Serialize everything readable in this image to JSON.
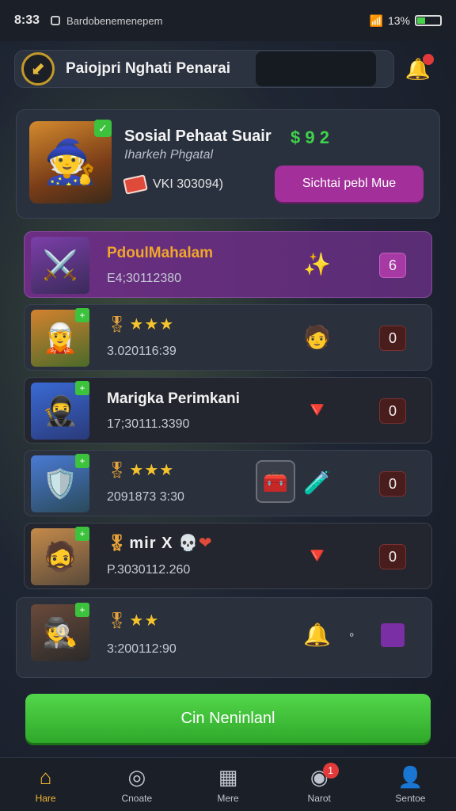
{
  "status_bar": {
    "time": "8:33",
    "notification_text": "Bardobenemenepem",
    "battery_text": "13%"
  },
  "header": {
    "title": "Paiojpri Nghati Penarai"
  },
  "profile": {
    "name": "Sosial Pehaat Suair",
    "subtitle": "Iharkeh Phgatal",
    "balance": "$ 9 2",
    "ticket_text": "VKI 303094)",
    "action_label": "Sichtai pebl Mue"
  },
  "rows": [
    {
      "title": "PdoulMahalam",
      "time": "E4;30112380",
      "badge": "6",
      "icon": "sparkle-star-icon",
      "avatar": "warrior-purple"
    },
    {
      "stars": "★★★",
      "time": "3.020116:39",
      "badge": "0",
      "icon": "character-icon",
      "avatar": "warrior-green"
    },
    {
      "title": "Marigka Perimkani",
      "time": "17;30111.3390",
      "badge": "0",
      "icon": "gem-icon",
      "avatar": "warrior-blue"
    },
    {
      "stars": "★★★",
      "time": "2091873 3:30",
      "badge": "0",
      "icon": "potion-icon",
      "avatar": "knight-blue"
    },
    {
      "title": "mir X",
      "time": "P.3030112.260",
      "badge": "0",
      "icon": "crystal-icon",
      "avatar": "warrior-bearded"
    },
    {
      "stars": "★★",
      "time": "3:200112:90",
      "badge": "",
      "icon": "bell-icon",
      "avatar": "warrior-hooded"
    }
  ],
  "cta": {
    "label": "Cin Neninlanl"
  },
  "nav": [
    {
      "label": "Hare",
      "icon": "home-icon"
    },
    {
      "label": "Cnoate",
      "icon": "search-icon"
    },
    {
      "label": "Mere",
      "icon": "grid-icon"
    },
    {
      "label": "Narot",
      "icon": "notification-icon",
      "badge": "1"
    },
    {
      "label": "Sentoe",
      "icon": "profile-icon"
    }
  ]
}
